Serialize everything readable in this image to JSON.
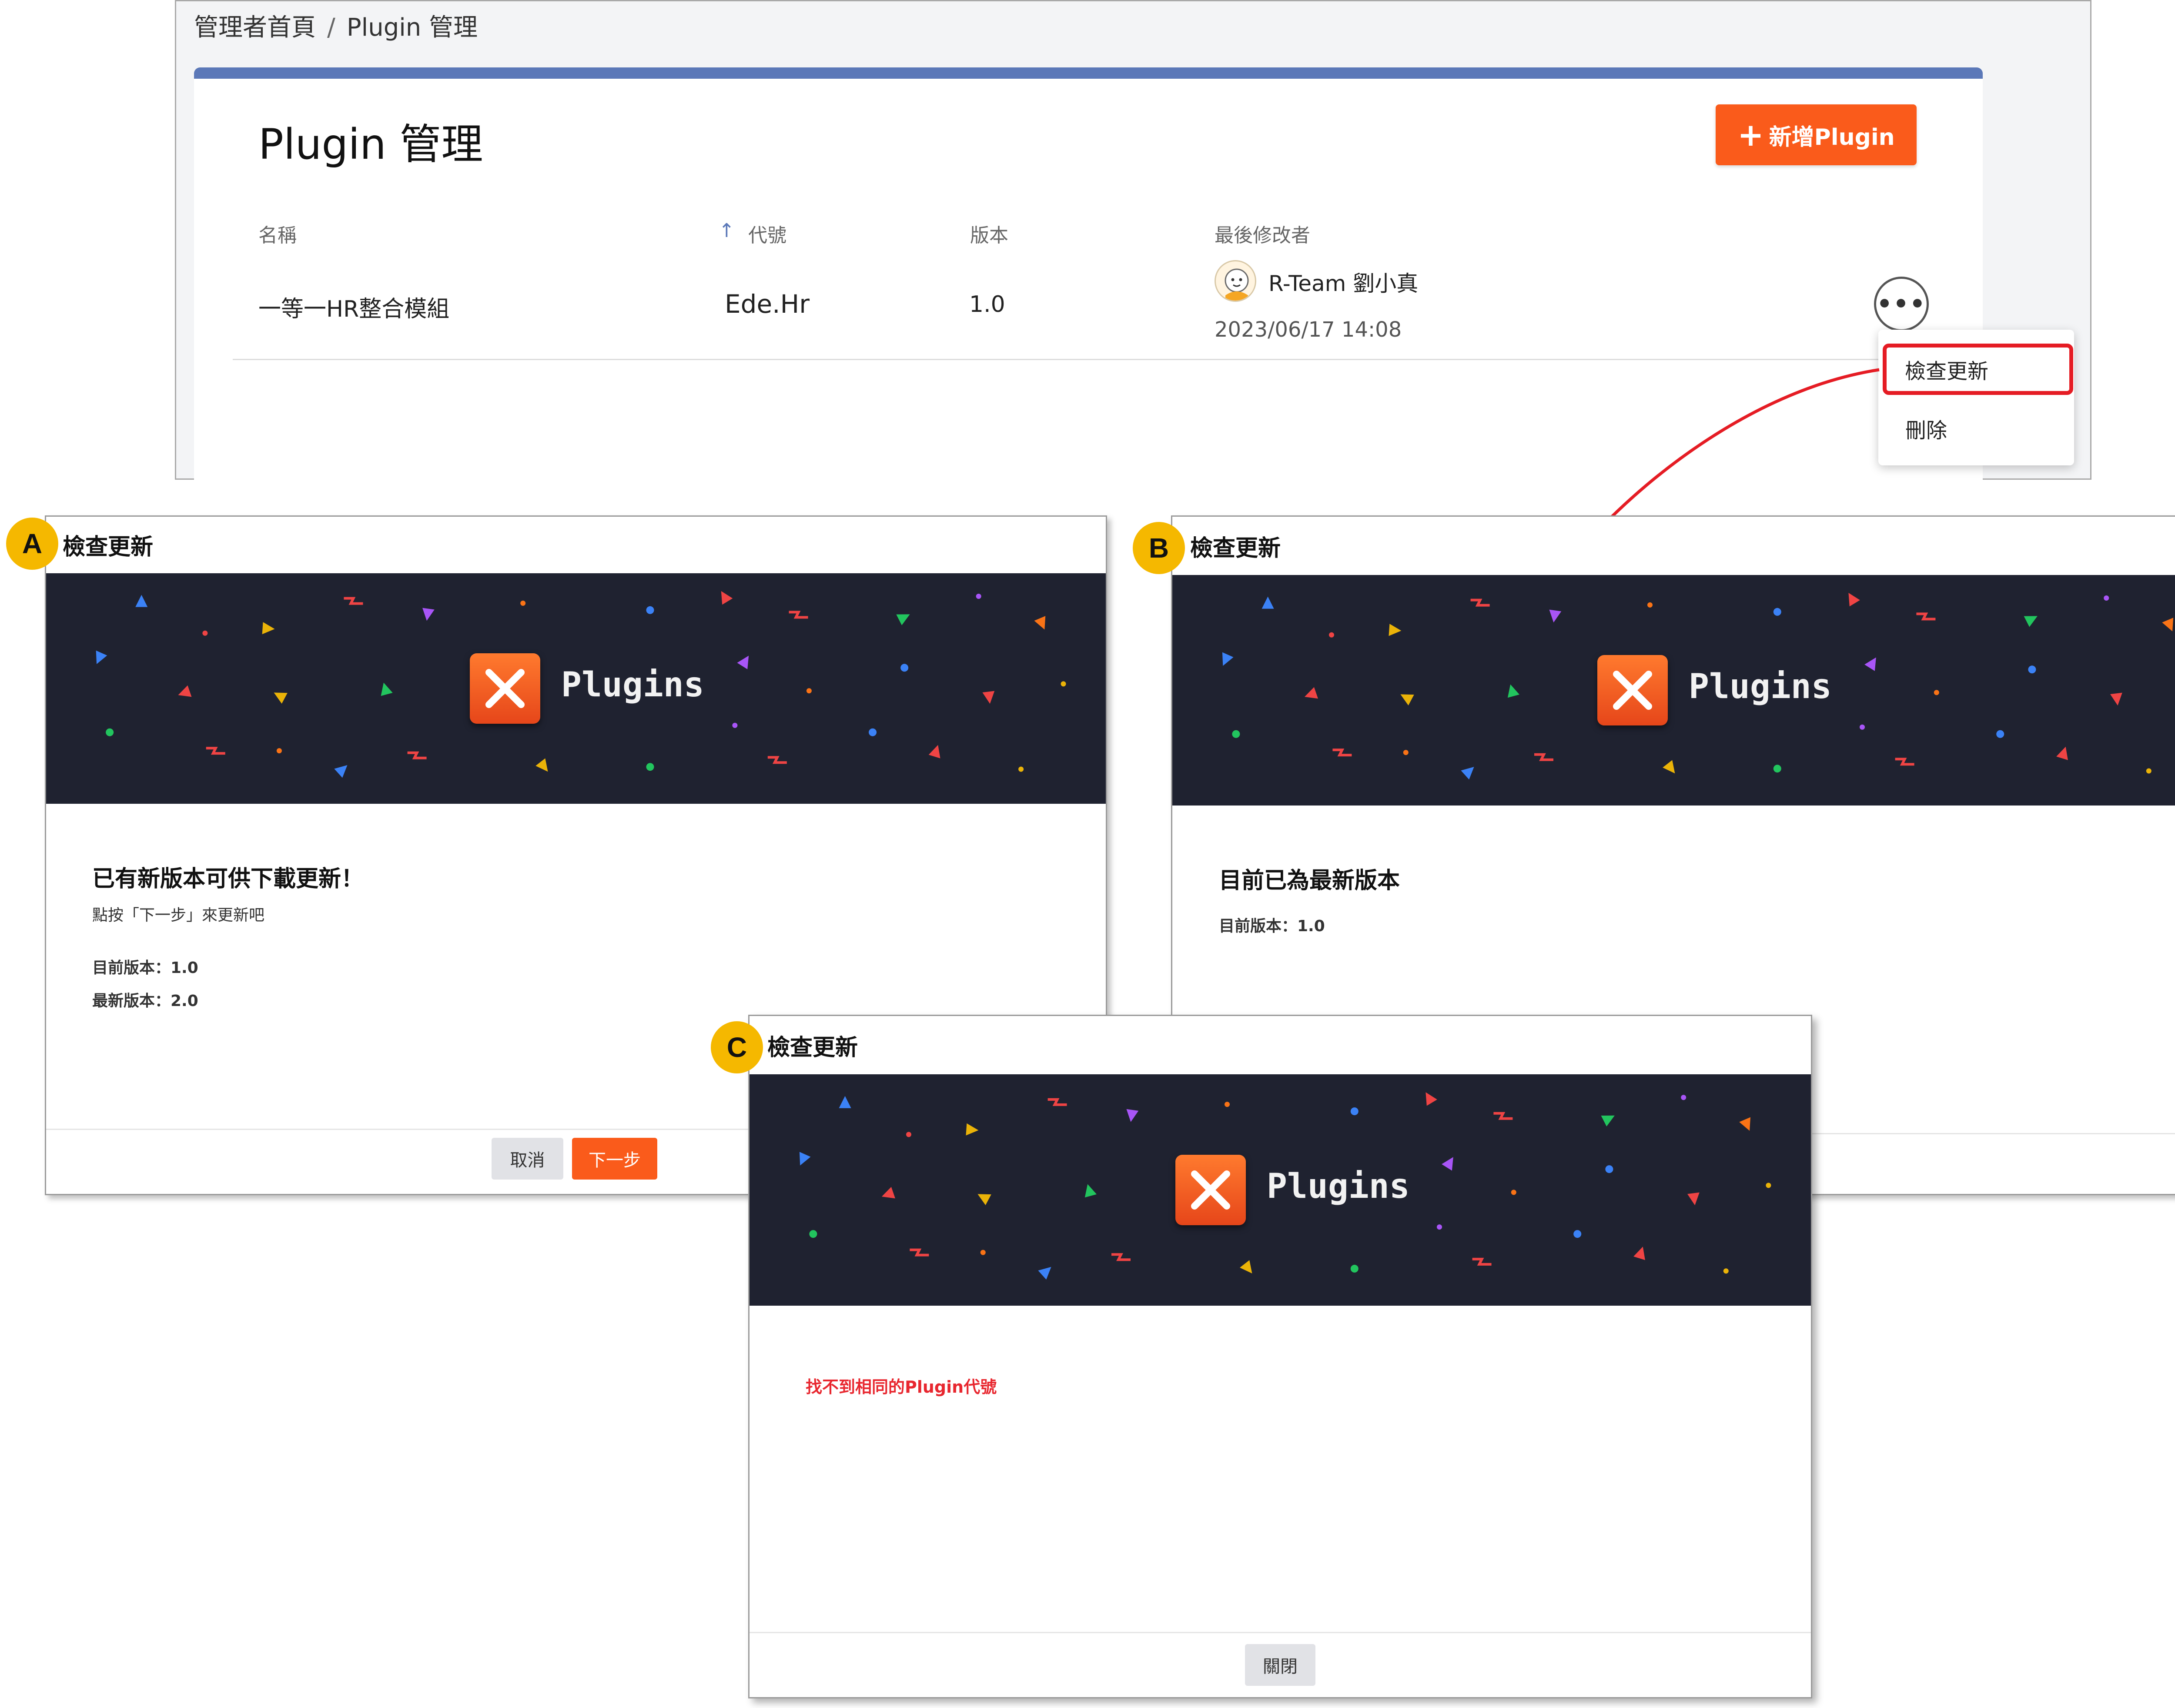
{
  "admin": {
    "breadcrumb": {
      "home": "管理者首頁",
      "separator": "/",
      "current": "Plugin 管理"
    },
    "page_title": "Plugin 管理",
    "add_button": {
      "icon": "plus-icon",
      "label": "新增Plugin"
    },
    "table": {
      "columns": {
        "name": "名稱",
        "code": "代號",
        "version": "版本",
        "modifier": "最後修改者"
      },
      "sort_icon": "arrow-up-icon",
      "rows": [
        {
          "name": "一等一HR整合模組",
          "code": "Ede.Hr",
          "version": "1.0",
          "modifier_name": "R-Team 劉小真",
          "modified_at": "2023/06/17 14:08"
        }
      ]
    },
    "more_button": "•••",
    "menu": {
      "check_update": "檢查更新",
      "delete": "刪除"
    }
  },
  "dialogs": {
    "a": {
      "badge": "A",
      "title": "檢查更新",
      "logo_text": "Plugins",
      "heading": "已有新版本可供下載更新！",
      "hint": "點按「下一步」來更新吧",
      "current_version": "目前版本：1.0",
      "latest_version": "最新版本：2.0",
      "cancel": "取消",
      "next": "下一步"
    },
    "b": {
      "badge": "B",
      "title": "檢查更新",
      "logo_text": "Plugins",
      "heading": "目前已為最新版本",
      "current_version": "目前版本：1.0"
    },
    "c": {
      "badge": "C",
      "title": "檢查更新",
      "logo_text": "Plugins",
      "error": "找不到相同的Plugin代號",
      "close": "關閉"
    }
  },
  "colors": {
    "accent": "#fa5b1b",
    "header_bar": "#5b78b8",
    "banner_bg": "#1f2230",
    "badge": "#f5b800",
    "error": "#e8272f",
    "highlight": "#e51c24"
  }
}
